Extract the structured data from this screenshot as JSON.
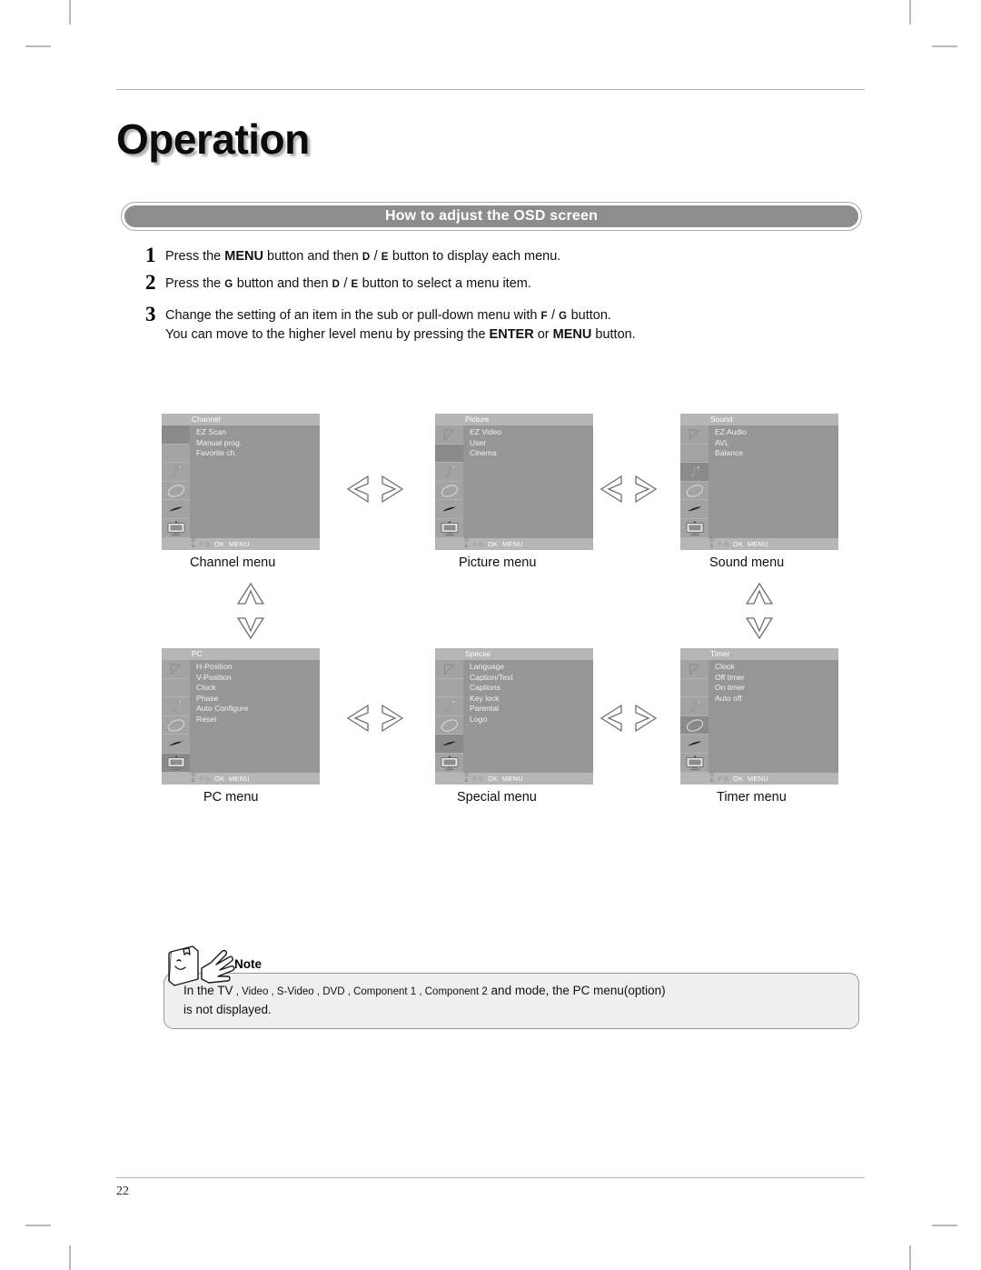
{
  "page": {
    "title": "Operation",
    "number": "22"
  },
  "banner": {
    "label": "How to adjust the OSD screen"
  },
  "steps": [
    {
      "num": "1",
      "parts": [
        "Press the ",
        "MENU",
        " button and then ",
        "D",
        " / ",
        "E",
        "  button to display each menu."
      ]
    },
    {
      "num": "2",
      "parts": [
        "Press the ",
        "G",
        " button and then ",
        "D",
        "  / ",
        "E",
        "  button to select a menu item."
      ]
    },
    {
      "num": "3",
      "parts": [
        "Change the setting of an item in the sub or pull-down menu with ",
        "F",
        " / ",
        "G",
        "  button."
      ],
      "parts2": [
        "You can move to the higher level menu by pressing the ",
        "ENTER",
        " or ",
        "MENU",
        " button."
      ]
    }
  ],
  "step_text": {
    "s1_a": "Press the ",
    "s1_menu": "MENU",
    "s1_b": " button and then ",
    "s1_k1": "D",
    "s1_sl": " / ",
    "s1_k2": "E",
    "s1_c": "  button to display each menu.",
    "s2_a": "Press the ",
    "s2_k1": "G",
    "s2_b": " button and then ",
    "s2_k2": "D",
    "s2_sl": "  / ",
    "s2_k3": "E",
    "s2_c": "  button to select a menu item.",
    "s3_a": "Change the setting of an item in the sub or pull-down menu with ",
    "s3_k1": "F",
    "s3_sl": " / ",
    "s3_k2": "G",
    "s3_b": "  button.",
    "s3_l2a": "You can move to the higher level menu by pressing the ",
    "s3_enter": "ENTER",
    "s3_l2b": " or ",
    "s3_menu": "MENU",
    "s3_l2c": " button."
  },
  "osd_footer": {
    "d": "D",
    "e": "E",
    "fg": "F G",
    "ok": "OK",
    "menu": "MENU"
  },
  "menus": [
    {
      "id": "channel",
      "title": "Channel",
      "caption": "Channel menu",
      "selected_icon": 0,
      "items": [
        "EZ Scan",
        "Manual prog.",
        "Favorite ch."
      ]
    },
    {
      "id": "picture",
      "title": "Picture",
      "caption": "Picture menu",
      "selected_icon": 1,
      "items": [
        "EZ Video",
        "User",
        "Cinema"
      ]
    },
    {
      "id": "sound",
      "title": "Sound",
      "caption": "Sound menu",
      "selected_icon": 2,
      "items": [
        "EZ Audio",
        "AVL",
        "Balance"
      ]
    },
    {
      "id": "pc",
      "title": "PC",
      "caption": "PC menu",
      "selected_icon": 5,
      "items": [
        "H-Position",
        "V-Position",
        "Clock",
        "Phase",
        "Auto Configure",
        "Reset"
      ]
    },
    {
      "id": "special",
      "title": "Special",
      "caption": "Special menu",
      "selected_icon": 4,
      "items": [
        "Language",
        "Caption/Text",
        "Captions",
        "Key lock",
        "Parental",
        "Logo"
      ]
    },
    {
      "id": "timer",
      "title": "Timer",
      "caption": "Timer menu",
      "selected_icon": 3,
      "items": [
        "Clock",
        "Off timer",
        "On timer",
        "Auto off"
      ]
    }
  ],
  "icon_names": [
    "antenna-icon",
    "picture-icon",
    "sound-note-icon",
    "timer-ellipse-icon",
    "special-swoosh-icon",
    "pc-monitor-icon"
  ],
  "note": {
    "label": "Note",
    "line1_a": "In the TV",
    "line1_b": " , Video",
    "line1_c": "  , S-Video",
    "line1_d": "  , DVD",
    "line1_e": " , Component 1",
    "line1_f": "    , Component 2",
    "line1_g": "     and mode, the PC menu(option)",
    "line2": "is not displayed."
  },
  "colors": {
    "banner_fill": "#8d8d8d",
    "osd_title": "#b6b6b6",
    "osd_body": "#969696",
    "osd_side": "#a3a3a3",
    "osd_selected": "#8a8a8a",
    "note_fill": "#efefef"
  }
}
